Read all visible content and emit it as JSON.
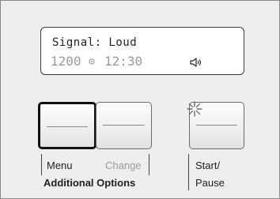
{
  "display": {
    "line1": "Signal: Loud",
    "temperature": "1200",
    "time": "12:30"
  },
  "icons": {
    "degree": "degree-circle-icon",
    "speaker": "speaker-icon",
    "sparkle": "sparkle-icon"
  },
  "buttons": {
    "menu_label": "Menu",
    "change_label": "Change",
    "group_label": "Additional Options",
    "start_label_line1": "Start/",
    "start_label_line2": "Pause"
  },
  "colors": {
    "panel": "#eeeeee",
    "dim_text": "#9a9a9a",
    "text": "#222222"
  }
}
